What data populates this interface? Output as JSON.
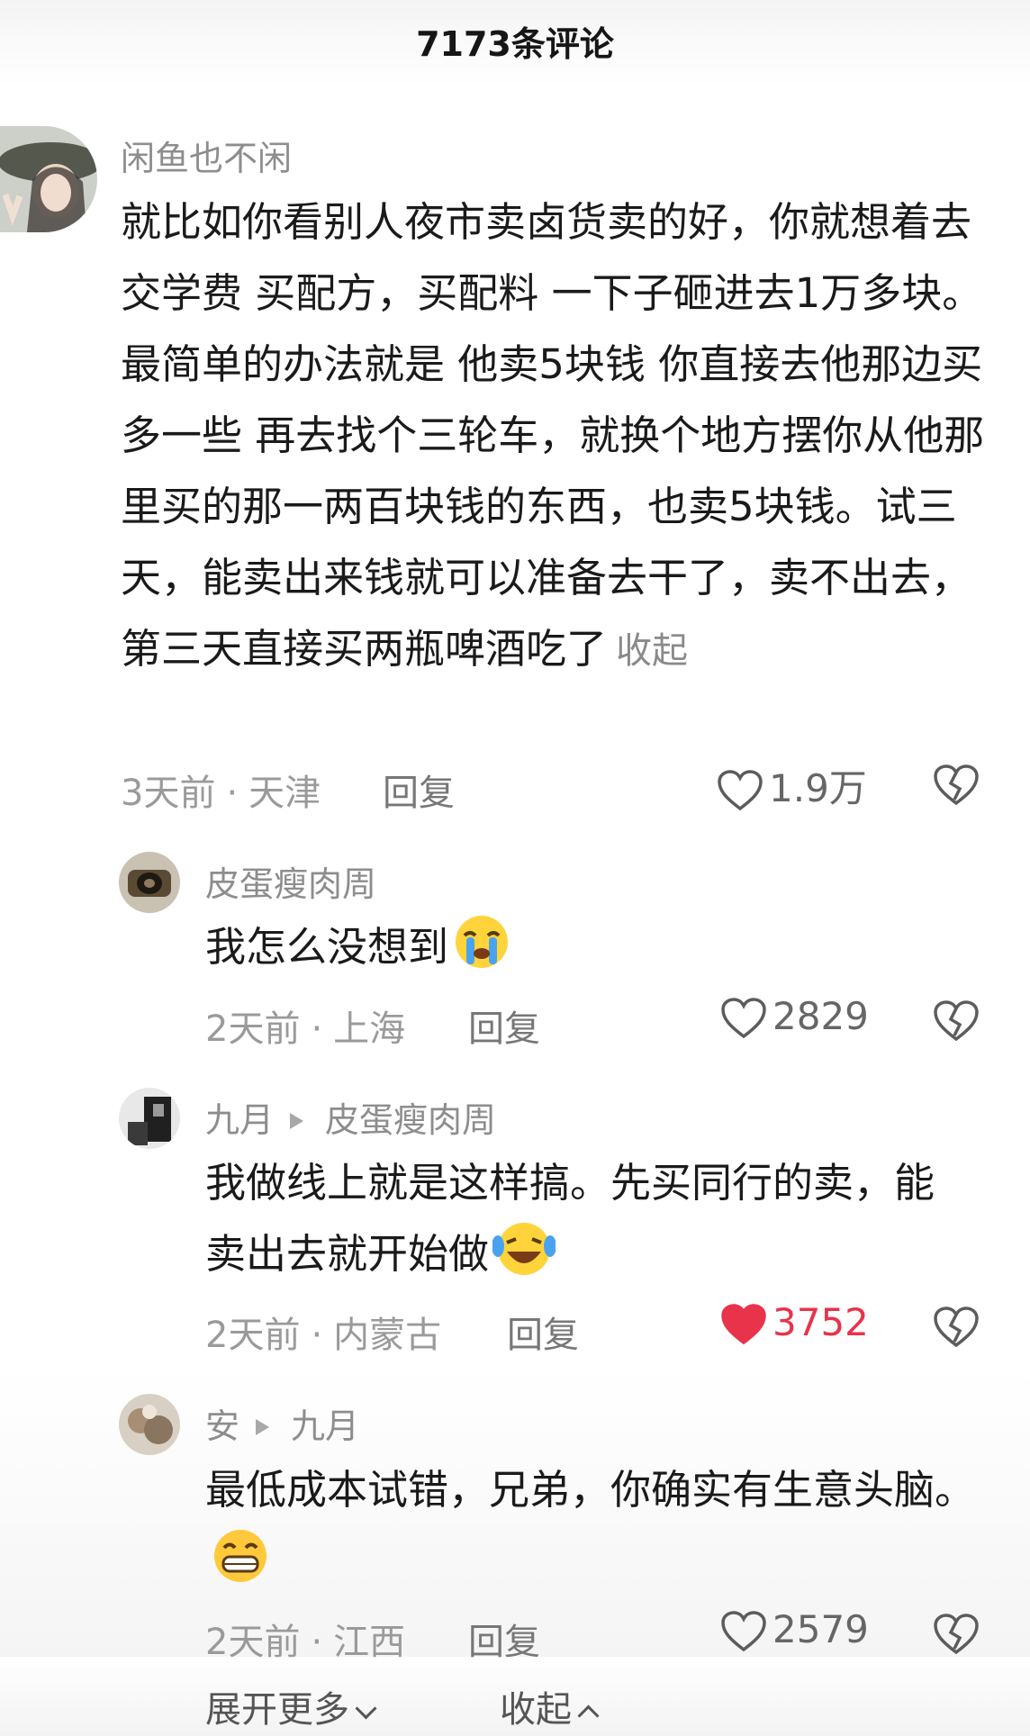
{
  "header": {
    "title": "7173条评论"
  },
  "comments": [
    {
      "username": "闲鱼也不闲",
      "text": "就比如你看别人夜市卖卤货卖的好，你就想着去交学费 买配方，买配料 一下子砸进去1万多块。 最简单的办法就是 他卖5块钱 你直接去他那边买多一些 再去找个三轮车，就换个地方摆你从他那里买的那一两百块钱的东西，也卖5块钱。试三天，能卖出来钱就可以准备去干了，卖不出去，第三天直接买两瓶啤酒吃了",
      "collapse_label": "收起",
      "time": "3天前",
      "location": "天津",
      "reply_label": "回复",
      "likes": "1.9万",
      "liked": false
    },
    {
      "username": "皮蛋瘦肉周",
      "text": "我怎么没想到",
      "emoji": "crying-face",
      "time": "2天前",
      "location": "上海",
      "reply_label": "回复",
      "likes": "2829",
      "liked": false
    },
    {
      "username": "九月",
      "reply_to": "皮蛋瘦肉周",
      "text": "我做线上就是这样搞。先买同行的卖，能卖出去就开始做",
      "emoji": "laughing-crying-face",
      "time": "2天前",
      "location": "内蒙古",
      "reply_label": "回复",
      "likes": "3752",
      "liked": true
    },
    {
      "username": "安",
      "reply_to": "九月",
      "text": "最低成本试错，兄弟，你确实有生意头脑。",
      "emoji": "grinning-face",
      "time": "2天前",
      "location": "江西",
      "reply_label": "回复",
      "likes": "2579",
      "liked": false
    }
  ],
  "footer": {
    "expand_more": "展开更多",
    "collapse": "收起"
  },
  "colors": {
    "liked": "#e8334a",
    "meta": "#9a9a9a",
    "username": "#8d8d8d"
  }
}
